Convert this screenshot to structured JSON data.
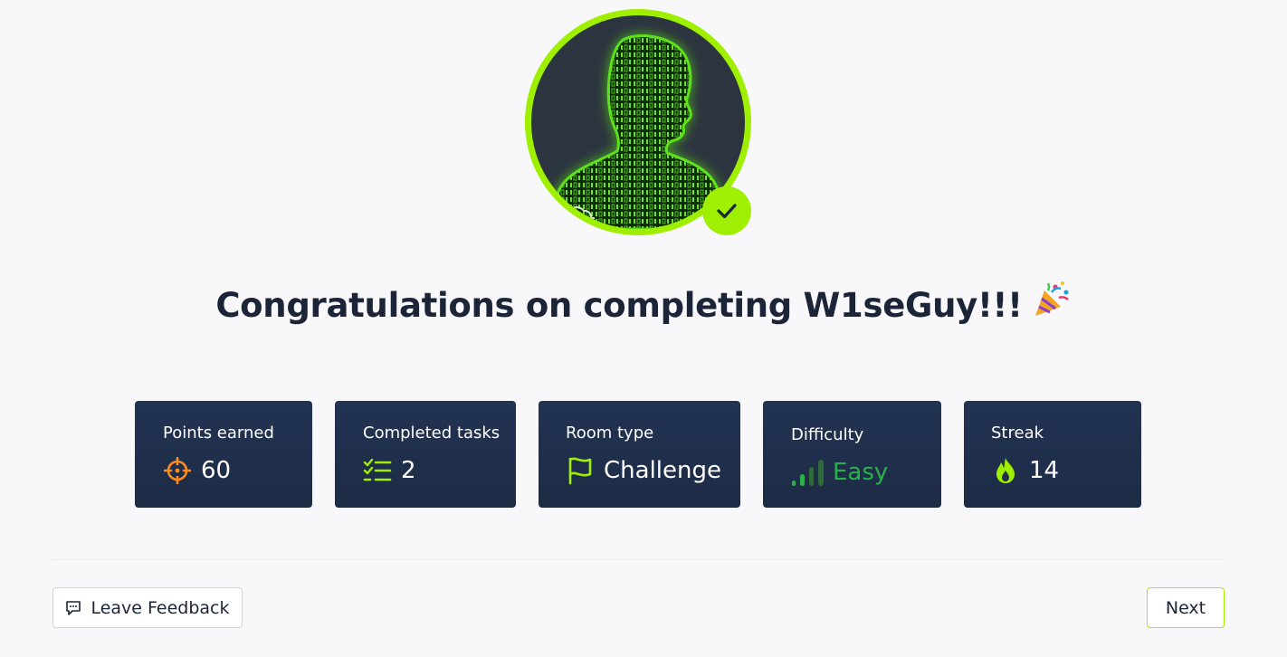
{
  "title": {
    "text": "Congratulations on completing W1seGuy!!!",
    "emoji_icon": "party-popper-icon"
  },
  "avatar": {
    "icon": "hacker-binary-silhouette",
    "completed_icon": "check-icon",
    "ring_color": "#9fef00"
  },
  "stats": [
    {
      "label": "Points earned",
      "value": "60",
      "icon": "crosshair-icon",
      "color": "#ff8c1a"
    },
    {
      "label": "Completed tasks",
      "value": "2",
      "icon": "checklist-icon",
      "color": "#9fef00"
    },
    {
      "label": "Room type",
      "value": "Challenge",
      "icon": "flag-icon",
      "color": "#9fef00"
    },
    {
      "label": "Difficulty",
      "value": "Easy",
      "icon": "signal-bars-icon",
      "color": "#2ab14b"
    },
    {
      "label": "Streak",
      "value": "14",
      "icon": "flame-icon",
      "color": "#9fef00"
    }
  ],
  "footer": {
    "feedback_label": "Leave Feedback",
    "feedback_icon": "message-icon",
    "next_label": "Next"
  }
}
